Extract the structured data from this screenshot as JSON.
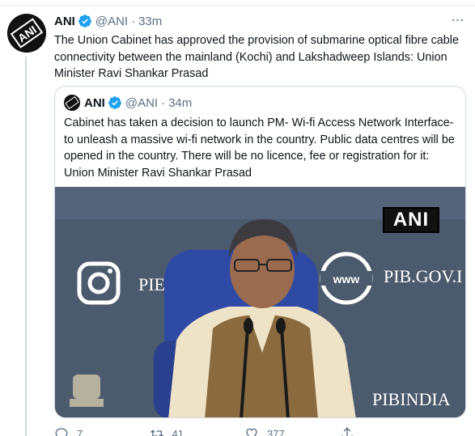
{
  "tweet": {
    "author_name": "ANI",
    "handle": "@ANI",
    "separator": "·",
    "time": "33m",
    "text": "The Union Cabinet has approved the provision of submarine optical fibre cable connectivity between the mainland (Kochi) and Lakshadweep Islands: Union Minister Ravi Shankar Prasad",
    "more_label": "⋯",
    "avatar_text": "ANI"
  },
  "quoted": {
    "author_name": "ANI",
    "handle": "@ANI",
    "separator": "·",
    "time": "34m",
    "text": "Cabinet has taken a decision to launch PM- Wi-fi Access Network Interface-to unleash a massive wi-fi network in the country. Public data centres will be opened in the country. There will be no licence, fee or registration for it: Union Minister Ravi Shankar Prasad",
    "image": {
      "watermark": "ANI",
      "backdrop_text_url": "PIB.GOV.I",
      "backdrop_text_left": "PIE",
      "backdrop_text_bottom": "PIBINDIA"
    }
  },
  "actions": {
    "reply_count": "7",
    "retweet_count": "41",
    "like_count": "377"
  },
  "colors": {
    "verified": "#1da1f2",
    "secondary_text": "#5b7083",
    "border": "#cfd9de"
  }
}
